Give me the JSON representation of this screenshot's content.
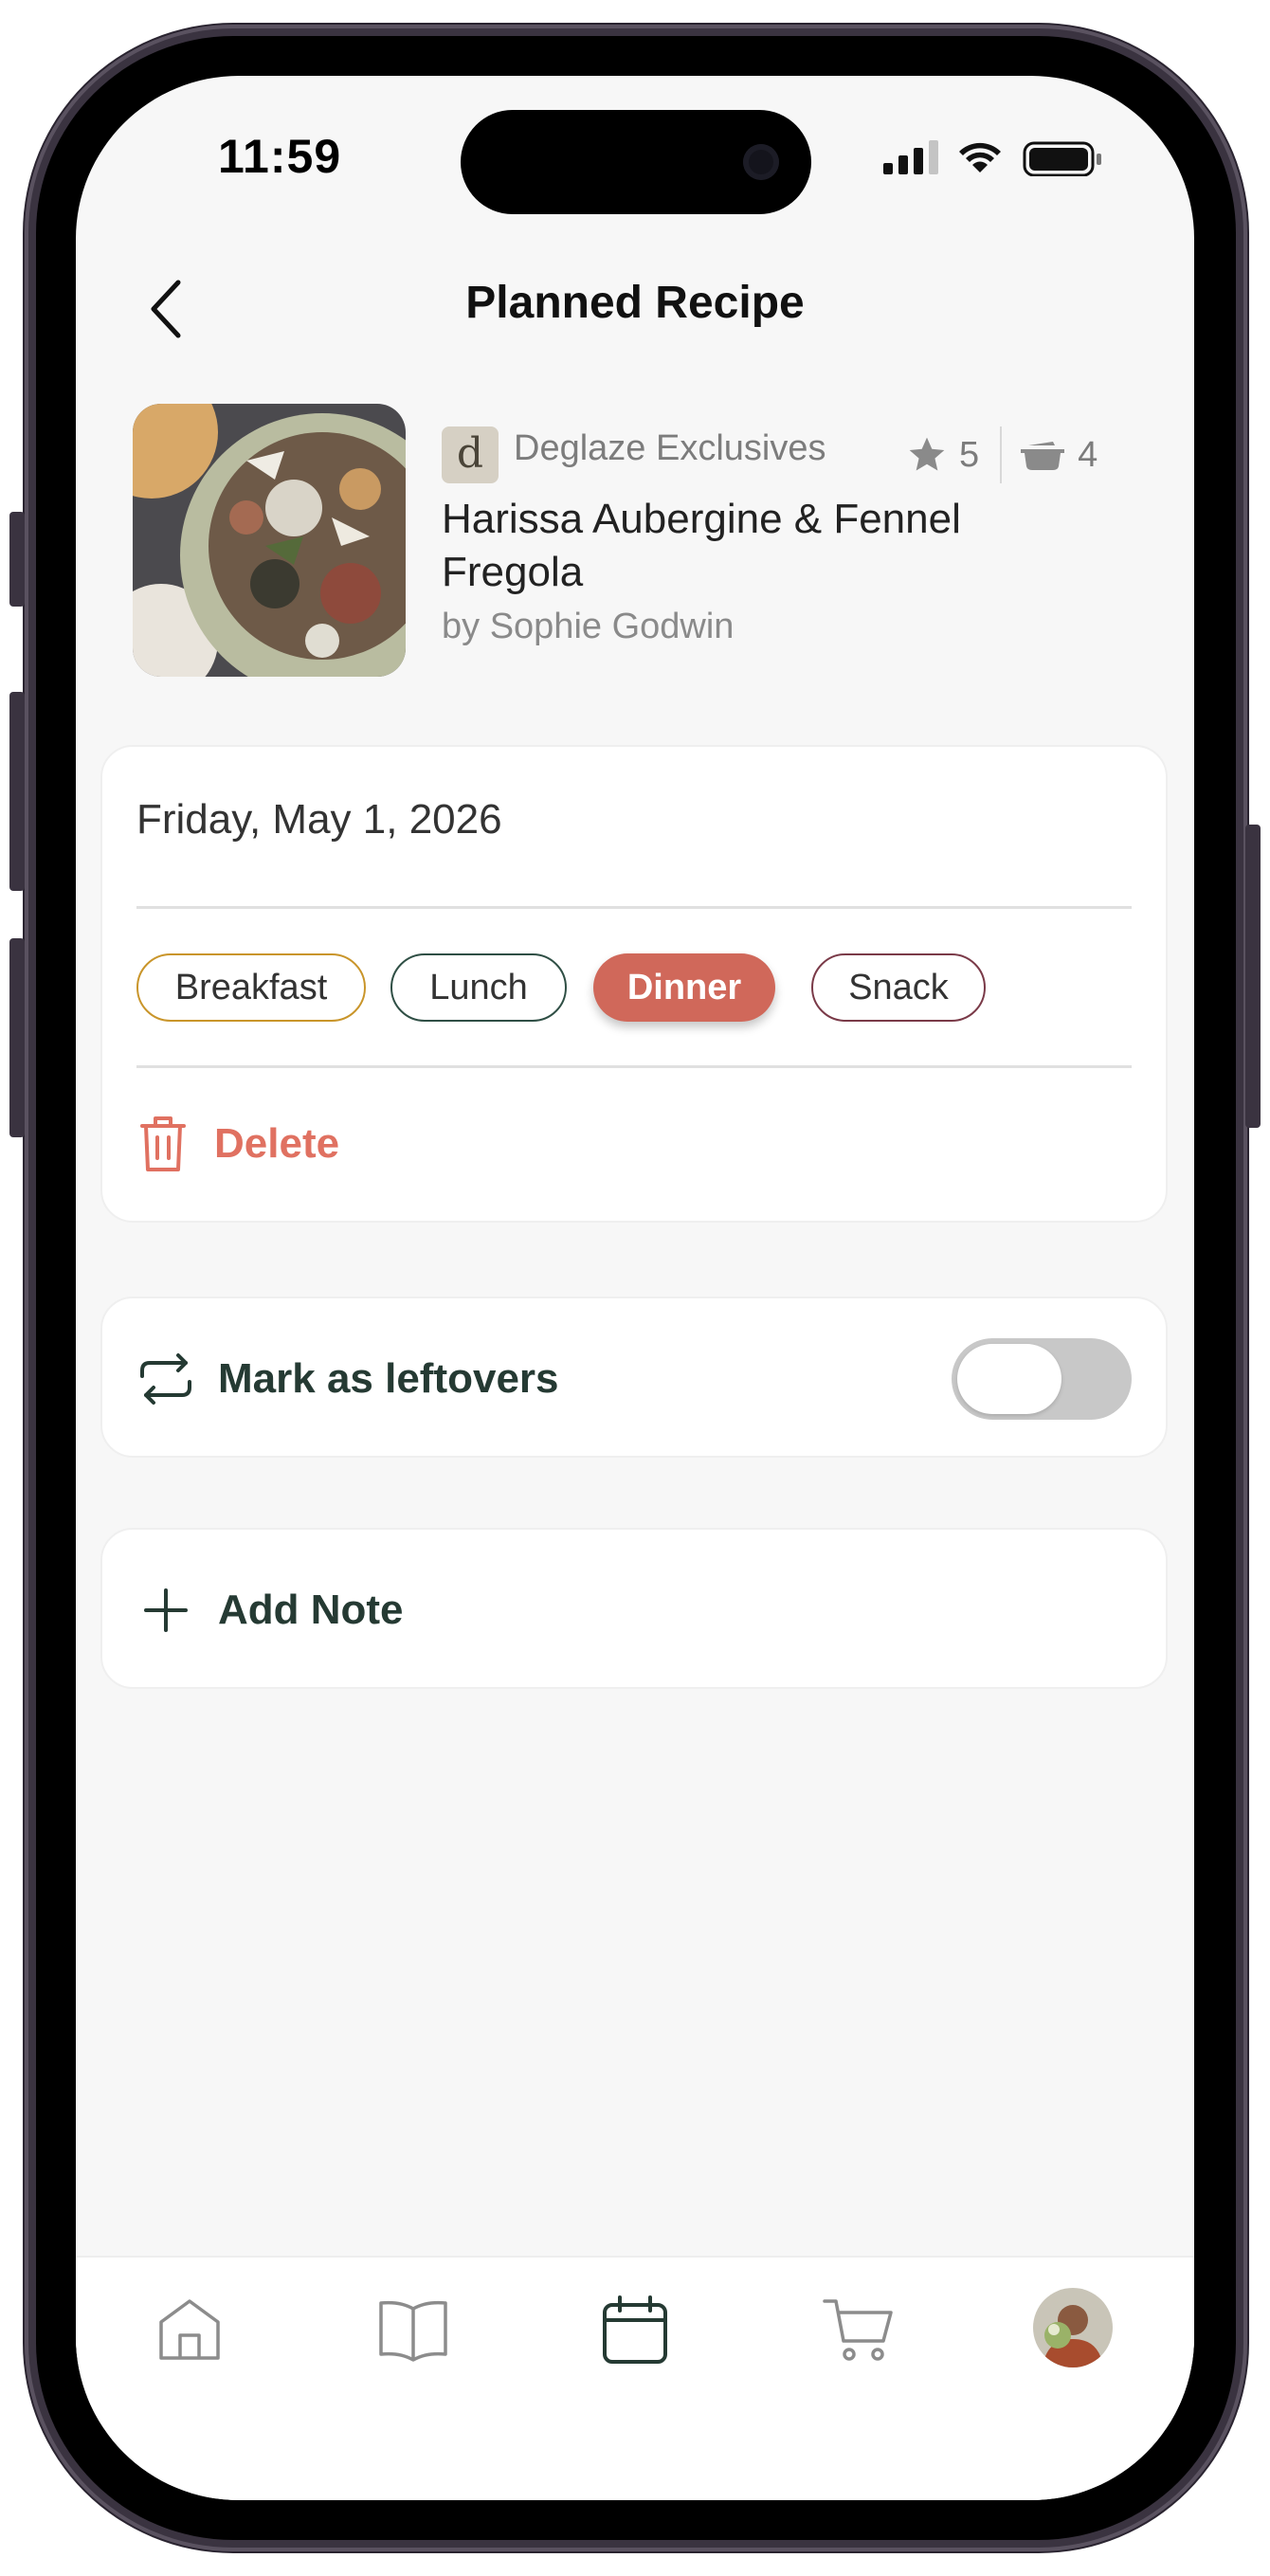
{
  "status_bar": {
    "time": "11:59"
  },
  "header": {
    "title": "Planned Recipe"
  },
  "recipe": {
    "source_badge": "d",
    "source_name": "Deglaze Exclusives",
    "rating": "5",
    "servings": "4",
    "title": "Harissa Aubergine & Fennel Fregola",
    "author": "by Sophie Godwin"
  },
  "plan": {
    "date": "Friday, May 1, 2026",
    "meals": [
      {
        "label": "Breakfast",
        "color": "#c9952a",
        "selected": false
      },
      {
        "label": "Lunch",
        "color": "#2f4f45",
        "selected": false
      },
      {
        "label": "Dinner",
        "color": "#d0685a",
        "selected": true
      },
      {
        "label": "Snack",
        "color": "#7a3a48",
        "selected": false
      }
    ],
    "delete_label": "Delete"
  },
  "leftovers": {
    "label": "Mark as leftovers",
    "enabled": false
  },
  "note": {
    "label": "Add Note"
  },
  "tabbar": {
    "items": [
      "home-icon",
      "recipe-book-icon",
      "calendar-icon",
      "cart-icon",
      "profile-avatar"
    ],
    "active": "calendar-icon"
  },
  "colors": {
    "accent_red": "#e07161",
    "dark_green": "#253a33",
    "background": "#f7f7f7"
  }
}
